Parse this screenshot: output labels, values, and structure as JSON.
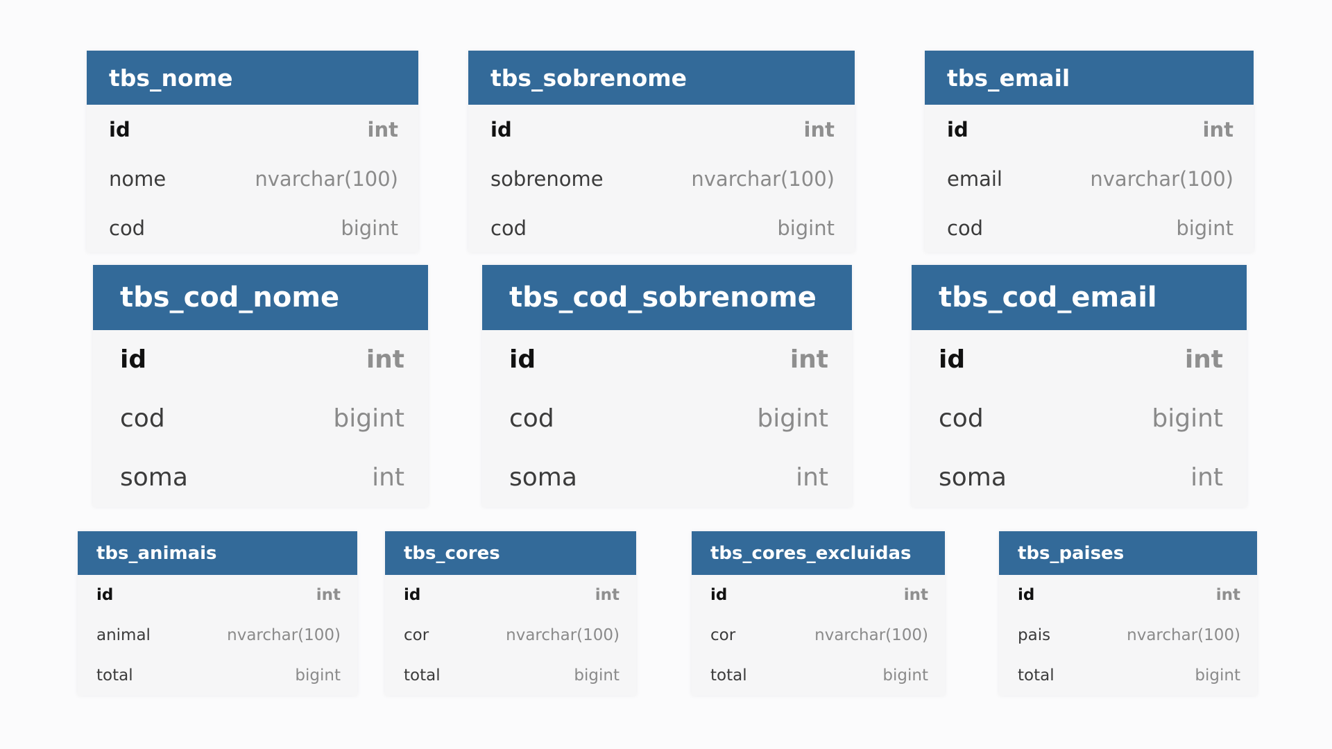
{
  "colors": {
    "header_bg": "#336a99",
    "header_text": "#ffffff",
    "body_bg": "#f6f6f7",
    "pk_name": "#111111",
    "type_text": "#8a8a8a"
  },
  "tables": [
    {
      "name": "tbs_nome",
      "columns": [
        {
          "name": "id",
          "type": "int",
          "pk": true
        },
        {
          "name": "nome",
          "type": "nvarchar(100)"
        },
        {
          "name": "cod",
          "type": "bigint"
        }
      ]
    },
    {
      "name": "tbs_sobrenome",
      "columns": [
        {
          "name": "id",
          "type": "int",
          "pk": true
        },
        {
          "name": "sobrenome",
          "type": "nvarchar(100)"
        },
        {
          "name": "cod",
          "type": "bigint"
        }
      ]
    },
    {
      "name": "tbs_email",
      "columns": [
        {
          "name": "id",
          "type": "int",
          "pk": true
        },
        {
          "name": "email",
          "type": "nvarchar(100)"
        },
        {
          "name": "cod",
          "type": "bigint"
        }
      ]
    },
    {
      "name": "tbs_cod_nome",
      "columns": [
        {
          "name": "id",
          "type": "int",
          "pk": true
        },
        {
          "name": "cod",
          "type": "bigint"
        },
        {
          "name": "soma",
          "type": "int"
        }
      ]
    },
    {
      "name": "tbs_cod_sobrenome",
      "columns": [
        {
          "name": "id",
          "type": "int",
          "pk": true
        },
        {
          "name": "cod",
          "type": "bigint"
        },
        {
          "name": "soma",
          "type": "int"
        }
      ]
    },
    {
      "name": "tbs_cod_email",
      "columns": [
        {
          "name": "id",
          "type": "int",
          "pk": true
        },
        {
          "name": "cod",
          "type": "bigint"
        },
        {
          "name": "soma",
          "type": "int"
        }
      ]
    },
    {
      "name": "tbs_animais",
      "columns": [
        {
          "name": "id",
          "type": "int",
          "pk": true
        },
        {
          "name": "animal",
          "type": "nvarchar(100)"
        },
        {
          "name": "total",
          "type": "bigint"
        }
      ]
    },
    {
      "name": "tbs_cores",
      "columns": [
        {
          "name": "id",
          "type": "int",
          "pk": true
        },
        {
          "name": "cor",
          "type": "nvarchar(100)"
        },
        {
          "name": "total",
          "type": "bigint"
        }
      ]
    },
    {
      "name": "tbs_cores_excluidas",
      "columns": [
        {
          "name": "id",
          "type": "int",
          "pk": true
        },
        {
          "name": "cor",
          "type": "nvarchar(100)"
        },
        {
          "name": "total",
          "type": "bigint"
        }
      ]
    },
    {
      "name": "tbs_paises",
      "columns": [
        {
          "name": "id",
          "type": "int",
          "pk": true
        },
        {
          "name": "pais",
          "type": "nvarchar(100)"
        },
        {
          "name": "total",
          "type": "bigint"
        }
      ]
    }
  ]
}
